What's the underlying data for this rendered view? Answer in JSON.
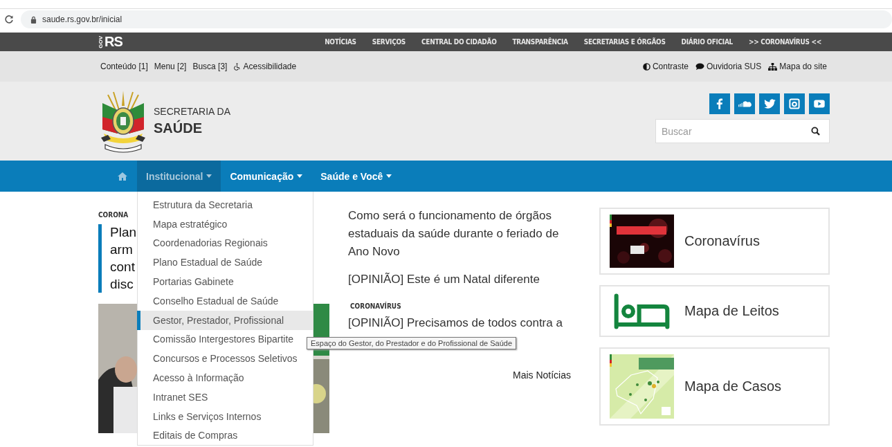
{
  "browser": {
    "url": "saude.rs.gov.br/inicial"
  },
  "topbar": {
    "brand": "RS",
    "brand_small": "GOV",
    "links": [
      {
        "label": "NOTÍCIAS"
      },
      {
        "label": "SERVIÇOS"
      },
      {
        "label": "CENTRAL DO CIDADÃO"
      },
      {
        "label": "TRANSPARÊNCIA"
      },
      {
        "label": "SECRETARIAS E ÓRGÃOS"
      },
      {
        "label": "DIÁRIO OFICIAL"
      },
      {
        "label": ">> CORONAVÍRUS <<"
      }
    ]
  },
  "access_bar": {
    "left": [
      {
        "label": "Conteúdo [1]",
        "kind": "plain"
      },
      {
        "label": "Menu [2]",
        "kind": "plain"
      },
      {
        "label": "Busca [3]",
        "kind": "plain"
      },
      {
        "label": "Acessibilidade",
        "kind": "wheelchair"
      }
    ],
    "right": [
      {
        "label": "Contraste",
        "kind": "contrast"
      },
      {
        "label": "Ouvidoria SUS",
        "kind": "speech"
      },
      {
        "label": "Mapa do site",
        "kind": "sitemap"
      }
    ]
  },
  "header": {
    "subtitle": "SECRETARIA DA",
    "title": "SAÚDE",
    "social": [
      {
        "kind": "facebook"
      },
      {
        "kind": "soundcloud"
      },
      {
        "kind": "twitter"
      },
      {
        "kind": "instagram"
      },
      {
        "kind": "youtube"
      }
    ],
    "search": {
      "placeholder": "Buscar"
    }
  },
  "nav": {
    "items": [
      {
        "label": "Institucional",
        "selected": true
      },
      {
        "label": "Comunicação",
        "selected": false
      },
      {
        "label": "Saúde e Você",
        "selected": false
      }
    ],
    "dropdown": [
      {
        "label": "Estrutura da Secretaria",
        "selected": false
      },
      {
        "label": "Mapa estratégico",
        "selected": false
      },
      {
        "label": "Coordenadorias Regionais",
        "selected": false
      },
      {
        "label": "Plano Estadual de Saúde",
        "selected": false
      },
      {
        "label": "Portarias Gabinete",
        "selected": false
      },
      {
        "label": "Conselho Estadual de Saúde",
        "selected": false
      },
      {
        "label": "Gestor, Prestador, Profissional",
        "selected": true
      },
      {
        "label": "Comissão Intergestores Bipartite",
        "selected": false
      },
      {
        "label": "Concursos e Processos Seletivos",
        "selected": false
      },
      {
        "label": "Acesso à Informação",
        "selected": false
      },
      {
        "label": "Intranet SES",
        "selected": false
      },
      {
        "label": "Links e Serviços Internos",
        "selected": false
      },
      {
        "label": "Editais de Compras",
        "selected": false
      }
    ]
  },
  "tooltip": "Espaço do Gestor, do Prestador e do Profissional de Saúde",
  "feature": {
    "tag": "CORONA",
    "headline_lines": [
      "Plan",
      "arm",
      "cont",
      "disc"
    ]
  },
  "news": [
    {
      "title": "Como será o funcionamento de órgãos estaduais da saúde durante o feriado de Ano Novo"
    },
    {
      "title": "[OPINIÃO] Este é um Natal diferente"
    },
    {
      "tag": "CORONAVÍRUS",
      "title": "[OPINIÃO] Precisamos de todos contra a"
    }
  ],
  "more_news": "Mais Notícias",
  "cards": [
    {
      "title": "Coronavírus",
      "kind": "virus"
    },
    {
      "title": "Mapa de Leitos",
      "kind": "bed"
    },
    {
      "title": "Mapa de Casos",
      "kind": "map"
    }
  ]
}
